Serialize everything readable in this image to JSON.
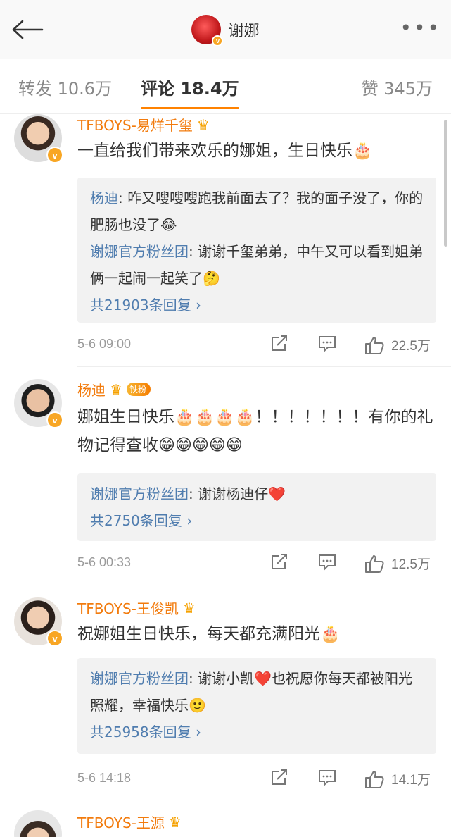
{
  "header": {
    "title": "谢娜"
  },
  "tabs": [
    {
      "label": "转发 10.6万"
    },
    {
      "label": "评论 18.4万"
    },
    {
      "label": "赞 345万"
    }
  ],
  "comments": [
    {
      "name": "TFBOYS-易烊千玺",
      "text": "一直给我们带来欢乐的娜姐，生日快乐🎂",
      "replies": [
        {
          "name": "杨迪",
          "text": ": 咋又嗖嗖嗖跑我前面去了？我的面子没了，你的肥肠也没了😂"
        },
        {
          "name": "谢娜官方粉丝团",
          "text": ": 谢谢千玺弟弟，中午又可以看到姐弟俩一起闹一起笑了🤔"
        }
      ],
      "more": "共21903条回复 ›",
      "time": "5-6 09:00",
      "likes": "22.5万"
    },
    {
      "name": "杨迪",
      "badge": "铁粉",
      "text": "娜姐生日快乐🎂🎂🎂🎂！！！！！！！有你的礼物记得查收😁😁😁😁😁",
      "replies": [
        {
          "name": "谢娜官方粉丝团",
          "text": ": 谢谢杨迪仔❤️"
        }
      ],
      "more": "共2750条回复 ›",
      "time": "5-6 00:33",
      "likes": "12.5万"
    },
    {
      "name": "TFBOYS-王俊凯",
      "text": "祝娜姐生日快乐，每天都充满阳光🎂",
      "replies": [
        {
          "name": "谢娜官方粉丝团",
          "text": ": 谢谢小凯❤️也祝愿你每天都被阳光照耀，幸福快乐🙂"
        }
      ],
      "more": "共25958条回复 ›",
      "time": "5-6 14:18",
      "likes": "14.1万"
    },
    {
      "name": "TFBOYS-王源"
    }
  ]
}
